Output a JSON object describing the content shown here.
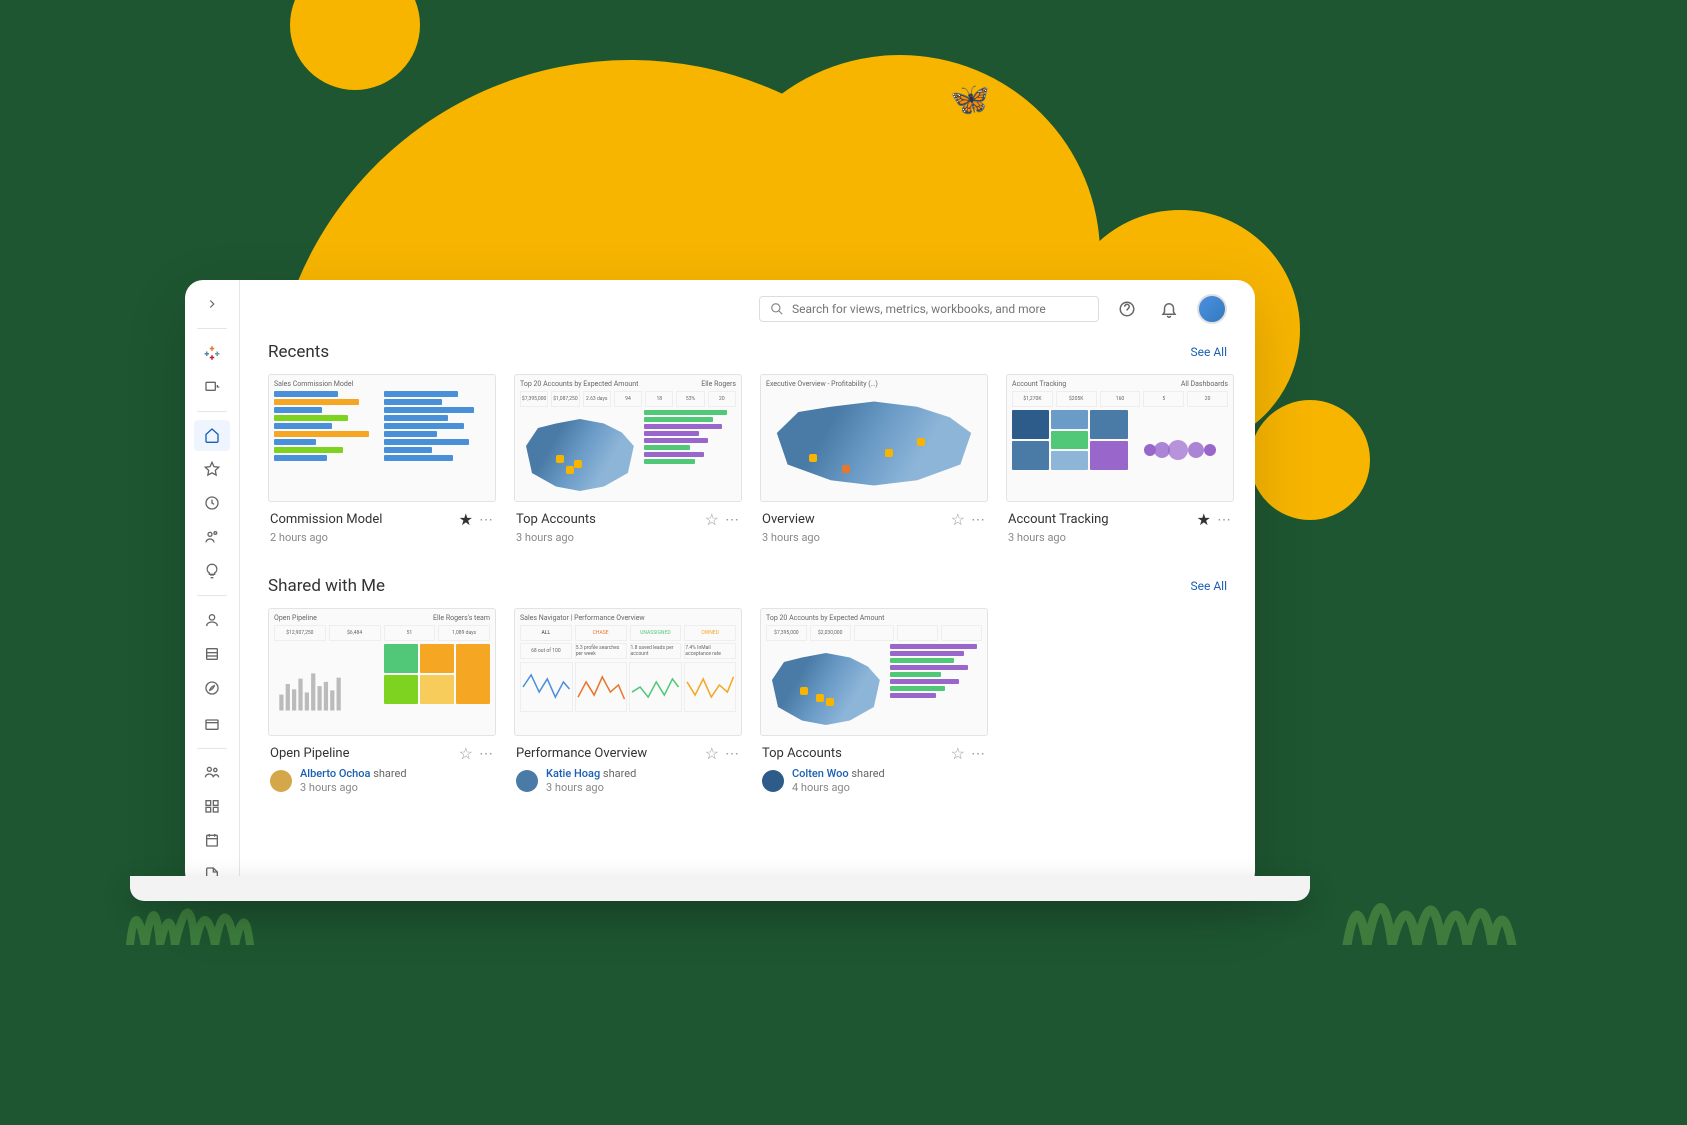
{
  "search": {
    "placeholder": "Search for views, metrics, workbooks, and more"
  },
  "sections": {
    "recents": {
      "title": "Recents",
      "see_all": "See All"
    },
    "shared": {
      "title": "Shared with Me",
      "see_all": "See All"
    }
  },
  "recents": [
    {
      "title": "Commission Model",
      "time": "2 hours ago",
      "starred": true,
      "thumb_title": "Sales Commission Model"
    },
    {
      "title": "Top Accounts",
      "time": "3 hours ago",
      "starred": false,
      "thumb_title": "Top 20 Accounts by Expected Amount",
      "thumb_owner": "Elle Rogers",
      "kpis": [
        "$7,395,000",
        "$1,087,250",
        "2.63 days",
        "94",
        "18",
        "53%",
        "20"
      ]
    },
    {
      "title": "Overview",
      "time": "3 hours ago",
      "starred": false,
      "thumb_title": "Executive Overview - Profitability (…)"
    },
    {
      "title": "Account Tracking",
      "time": "3 hours ago",
      "starred": true,
      "thumb_title": "Account Tracking",
      "thumb_sub": "All Dashboards",
      "kpis": [
        "$1,270K",
        "$205K",
        "160",
        "5",
        "20"
      ]
    }
  ],
  "shared": [
    {
      "title": "Open Pipeline",
      "starred": false,
      "thumb_title": "Open Pipeline",
      "thumb_owner": "Elle Rogers's team",
      "kpis": [
        "$12,907,250",
        "$6,484",
        "51",
        "1,089 days"
      ],
      "shared_by": "Alberto Ochoa",
      "shared_verb": "shared",
      "time": "3 hours ago"
    },
    {
      "title": "Performance Overview",
      "starred": false,
      "thumb_title": "Sales Navigator | Performance Overview",
      "tabs": [
        "ALL",
        "CHASE",
        "UNASSIGNED",
        "OWNED"
      ],
      "metrics": [
        "5.3 profile searches per week",
        "1.8 saved leads per account",
        "7.4% InMail acceptance rate"
      ],
      "stat": "68 out of 100",
      "shared_by": "Katie Hoag",
      "shared_verb": "shared",
      "time": "3 hours ago"
    },
    {
      "title": "Top Accounts",
      "starred": false,
      "thumb_title": "Top 20 Accounts by Expected Amount",
      "kpis": [
        "$7,395,000",
        "$2,030,000"
      ],
      "shared_by": "Colten Woo",
      "shared_verb": "shared",
      "time": "4 hours ago"
    }
  ]
}
